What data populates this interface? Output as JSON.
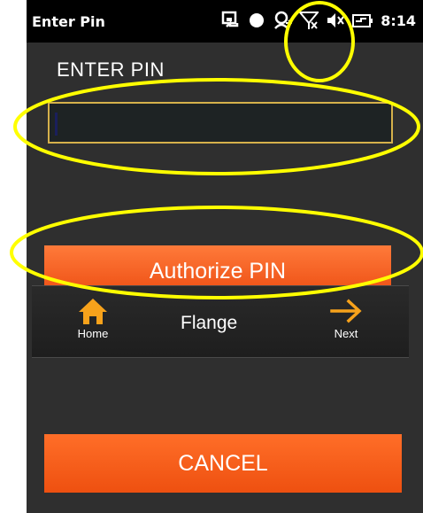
{
  "status_bar": {
    "title": "Enter Pin",
    "time": "8:14",
    "icons": [
      "sync-icon",
      "record-dot-icon",
      "user-location-icon",
      "signal-off-icon",
      "volume-muted-icon",
      "battery-charging-icon"
    ]
  },
  "pin": {
    "label": "ENTER PIN",
    "value": ""
  },
  "authorize_button": {
    "label": "Authorize PIN"
  },
  "flange_bar": {
    "title": "Flange",
    "home_label": "Home",
    "next_label": "Next"
  },
  "cancel_button": {
    "label": "CANCEL"
  },
  "colors": {
    "accent_orange": "#f0561a",
    "annotation_yellow": "#ffff00",
    "input_border": "#d6b14b",
    "background": "#2f2f2f"
  }
}
